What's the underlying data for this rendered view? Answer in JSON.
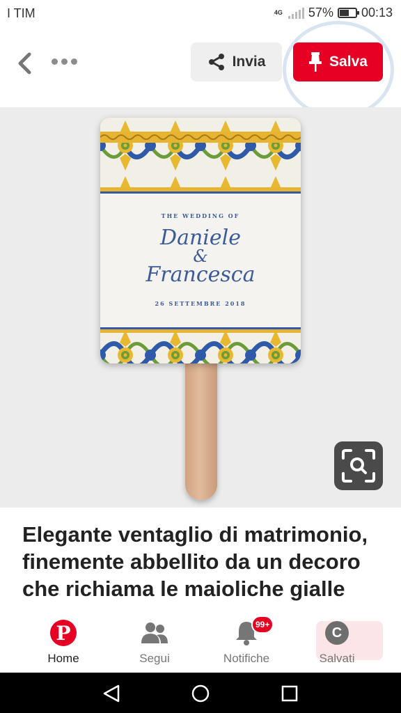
{
  "status_bar": {
    "carrier": "I TIM",
    "network": "4G",
    "battery_percent": "57%",
    "time": "00:13"
  },
  "topbar": {
    "back_icon": "chevron-left-icon",
    "more_icon": "more-horizontal-icon",
    "send_label": "Invia",
    "send_icon": "share-icon",
    "save_label": "Salva",
    "save_icon": "pushpin-icon",
    "save_color": "#e60023"
  },
  "pin_image": {
    "card_caption": "THE WEDDING OF",
    "name_1": "Daniele",
    "ampersand": "&",
    "name_2": "Francesca",
    "date": "26 SETTEMBRE 2018",
    "visual_search_icon": "visual-search-icon"
  },
  "pin_title": "Elegante ventaglio di matrimonio, finemente abbellito da un decoro che richiama le maioliche gialle",
  "bottom_nav": {
    "items": [
      {
        "label": "Home",
        "icon": "pinterest-logo-icon",
        "active": true
      },
      {
        "label": "Segui",
        "icon": "people-icon",
        "active": false
      },
      {
        "label": "Notifiche",
        "icon": "bell-icon",
        "badge": "99+",
        "active": false
      },
      {
        "label": "Salvati",
        "icon": "avatar-icon",
        "avatar_letter": "C",
        "active": false
      }
    ]
  },
  "system_nav": {
    "back_icon": "triangle-back-icon",
    "home_icon": "circle-home-icon",
    "recents_icon": "square-recents-icon"
  }
}
